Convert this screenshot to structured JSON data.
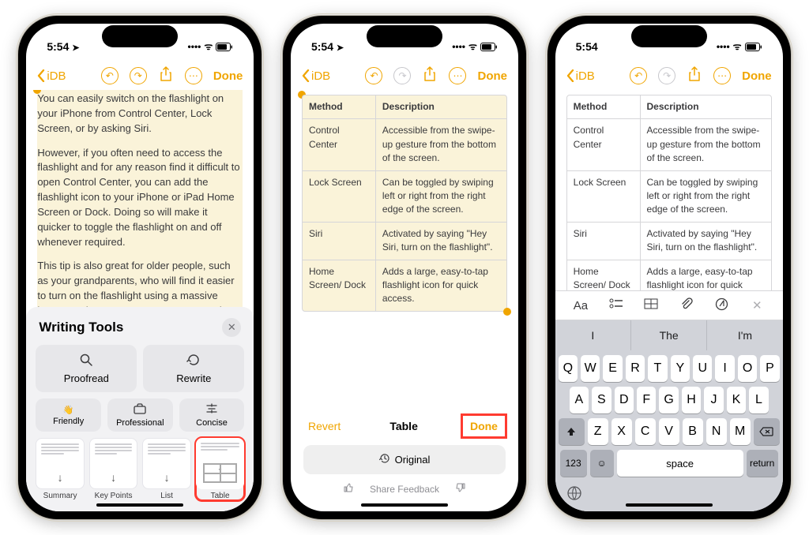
{
  "status": {
    "time": "5:54",
    "location_arrow": "➤"
  },
  "nav": {
    "back": "iDB",
    "done": "Done"
  },
  "phone1": {
    "para1": "You can easily switch on the flashlight on your iPhone from Control Center, Lock Screen, or by asking Siri.",
    "para2": "However, if you often need to access the flashlight and for any reason find it difficult to open Control Center, you can add the flashlight icon to your iPhone or iPad Home Screen or Dock. Doing so will make it quicker to toggle the flashlight on and off whenever required.",
    "para3": "This tip is also great for older people, such as your grandparents, who will find it easier to turn on the flashlight using a massive button on the Home Screen, as opposed to other methods.",
    "panel": {
      "title": "Writing Tools",
      "proofread": "Proofread",
      "rewrite": "Rewrite",
      "friendly": "Friendly",
      "professional": "Professional",
      "concise": "Concise",
      "summary": "Summary",
      "keypoints": "Key Points",
      "list": "List",
      "table": "Table"
    }
  },
  "table": {
    "h1": "Method",
    "h2": "Description",
    "rows": [
      {
        "c1": "Control Center",
        "c2": "Accessible from the swipe-up gesture from the bottom of the screen."
      },
      {
        "c1": "Lock Screen",
        "c2": "Can be toggled by swiping left or right from the right edge of the screen."
      },
      {
        "c1": "Siri",
        "c2": "Activated by saying \"Hey Siri, turn on the flashlight\"."
      },
      {
        "c1": "Home Screen/ Dock",
        "c2": "Adds a large, easy-to-tap flashlight icon for quick access."
      }
    ]
  },
  "phone2": {
    "revert": "Revert",
    "title": "Table",
    "done": "Done",
    "original": "Original",
    "feedback": "Share Feedback"
  },
  "phone3": {
    "format": {
      "aa": "Aa"
    },
    "suggest": [
      "I",
      "The",
      "I'm"
    ],
    "rows": [
      [
        "Q",
        "W",
        "E",
        "R",
        "T",
        "Y",
        "U",
        "I",
        "O",
        "P"
      ],
      [
        "A",
        "S",
        "D",
        "F",
        "G",
        "H",
        "J",
        "K",
        "L"
      ],
      [
        "Z",
        "X",
        "C",
        "V",
        "B",
        "N",
        "M"
      ]
    ],
    "num": "123",
    "space": "space",
    "return": "return"
  }
}
